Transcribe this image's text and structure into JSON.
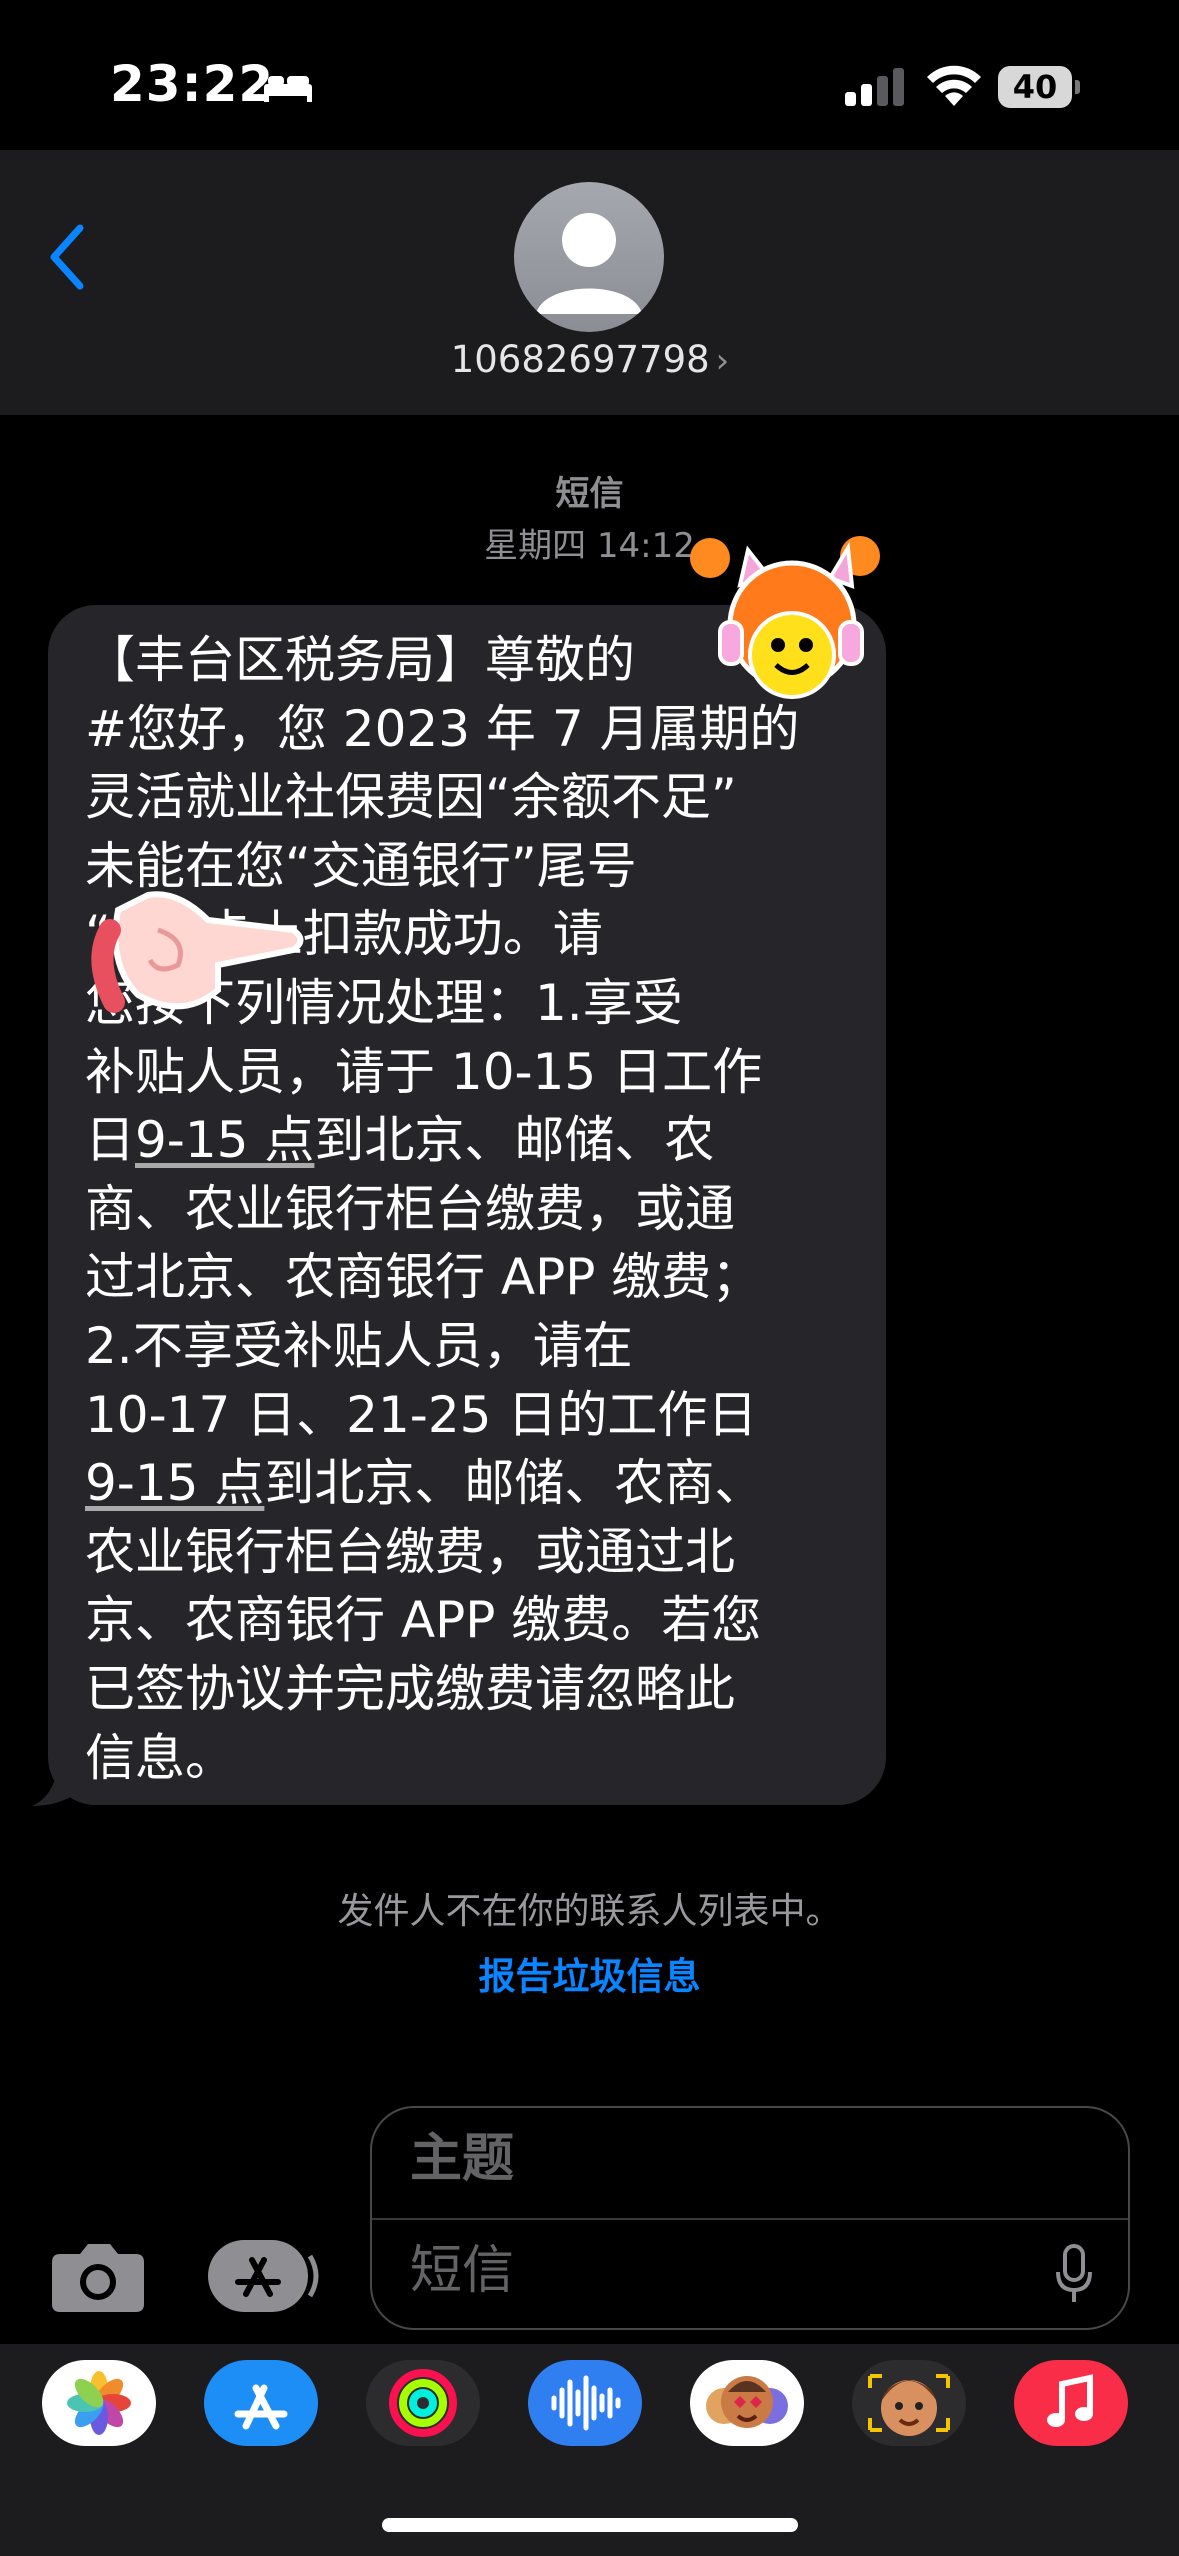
{
  "status": {
    "time": "23:22",
    "battery": "40",
    "icons": [
      "bed-icon",
      "signal-icon",
      "wifi-icon",
      "battery-icon"
    ]
  },
  "header": {
    "back_icon": "chevron-left-icon",
    "avatar_icon": "person-icon",
    "contact": "10682697798",
    "chevron": "›"
  },
  "conversation": {
    "channel": "短信",
    "timestamp": "星期四 14:12"
  },
  "message": {
    "line1": "【丰台区税务局】尊敬的",
    "line2": "#您好，您 2023 年 7 月属期的",
    "line3": "灵活就业社保费因“余额不足”",
    "line4": "未能在您“交通银行”尾号",
    "line5": "“      ”的卡上扣款成功。请",
    "line6": "您按下列情况处理：1.享受",
    "line7": "补贴人员，请于 10-15 日工作",
    "line8a": "日",
    "line8b": "9-15 点",
    "line8c": "到北京、邮储、农",
    "line9": "商、农业银行柜台缴费，或通",
    "line10": "过北京、农商银行 APP 缴费；",
    "line11": "2.不享受补贴人员，请在",
    "line12": "10-17 日、21-25 日的工作日",
    "line13a": "9-15 点",
    "line13b": "到北京、邮储、农商、",
    "line14": "农业银行柜台缴费，或通过北",
    "line15": "京、农商银行 APP 缴费。若您",
    "line16": "已签协议并完成缴费请忽略此",
    "line17": "信息。"
  },
  "footer": {
    "sender_note": "发件人不在你的联系人列表中。",
    "report_link": "报告垃圾信息"
  },
  "compose": {
    "subject_placeholder": "主题",
    "message_placeholder": "短信",
    "icons": [
      "camera-icon",
      "app-store-icon",
      "microphone-icon"
    ]
  },
  "app_drawer": [
    "photos-icon",
    "app-store-icon",
    "fitness-icon",
    "audio-message-icon",
    "memoji-stickers-icon",
    "memoji-icon",
    "music-icon"
  ],
  "colors": {
    "background": "#000000",
    "header_bg": "#1c1c1e",
    "bubble_bg": "#26252a",
    "link": "#0a84ff",
    "secondary_text": "#8e8e93"
  }
}
